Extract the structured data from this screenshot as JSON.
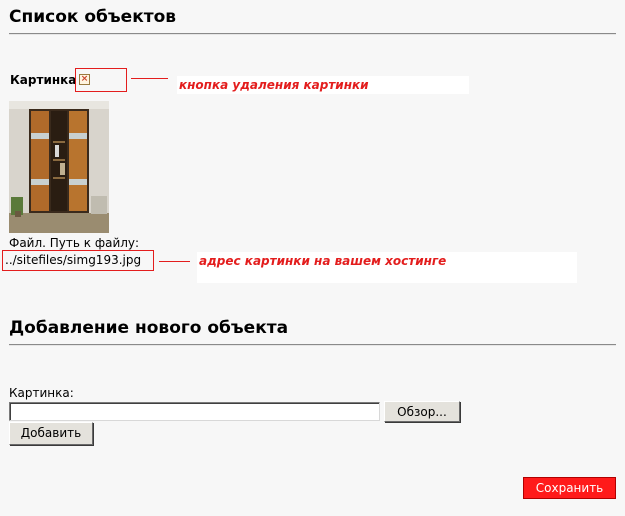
{
  "list_section": {
    "title": "Список объектов",
    "picture_label": "Картинка",
    "delete_annotation": "кнопка удаления картинки",
    "file_path_label": "Файл. Путь к файлу:",
    "file_path_value": "../sitefiles/simg193.jpg",
    "path_annotation": "адрес картинки на вашем хостинге"
  },
  "add_section": {
    "title": "Добавление нового объекта",
    "picture_label": "Картинка:",
    "browse_button": "Обзор...",
    "add_button": "Добавить"
  },
  "footer": {
    "save_button": "Сохранить"
  },
  "icons": {
    "delete": "delete-checkbox-icon"
  },
  "colors": {
    "annotation": "#e31d1d",
    "save_bg": "#ff1a1a"
  }
}
